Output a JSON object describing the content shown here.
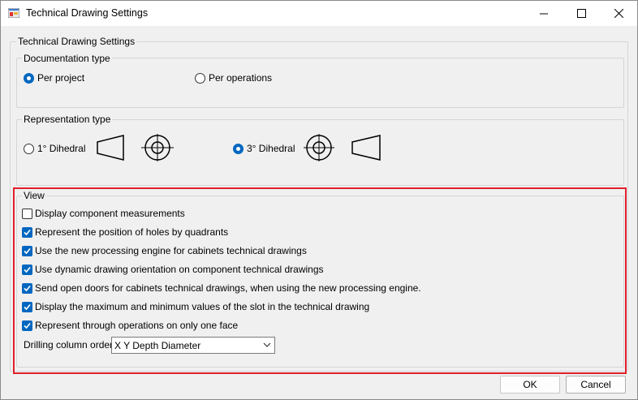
{
  "window": {
    "title": "Technical Drawing Settings"
  },
  "main_group": {
    "legend": "Technical Drawing Settings"
  },
  "documentation": {
    "legend": "Documentation type",
    "options": [
      {
        "label": "Per project",
        "selected": true
      },
      {
        "label": "Per operations",
        "selected": false
      }
    ]
  },
  "representation": {
    "legend": "Representation type",
    "options": [
      {
        "label": "1° Dihedral",
        "selected": false
      },
      {
        "label": "3° Dihedral",
        "selected": true
      }
    ]
  },
  "view": {
    "legend": "View",
    "checkboxes": [
      {
        "label": "Display component measurements",
        "checked": false
      },
      {
        "label": "Represent the position of holes by quadrants",
        "checked": true
      },
      {
        "label": "Use the new processing engine for cabinets technical drawings",
        "checked": true
      },
      {
        "label": "Use dynamic drawing orientation on component technical drawings",
        "checked": true
      },
      {
        "label": "Send open doors for cabinets technical drawings, when using the new processing engine.",
        "checked": true
      },
      {
        "label": "Display the maximum and minimum values of the slot in the technical drawing",
        "checked": true
      },
      {
        "label": "Represent through operations on only one face",
        "checked": true
      }
    ],
    "drilling_label": "Drilling column order",
    "drilling_value": "X Y Depth Diameter"
  },
  "buttons": {
    "ok": "OK",
    "cancel": "Cancel"
  },
  "colors": {
    "accent": "#0067c0",
    "highlight": "#e0202a"
  }
}
